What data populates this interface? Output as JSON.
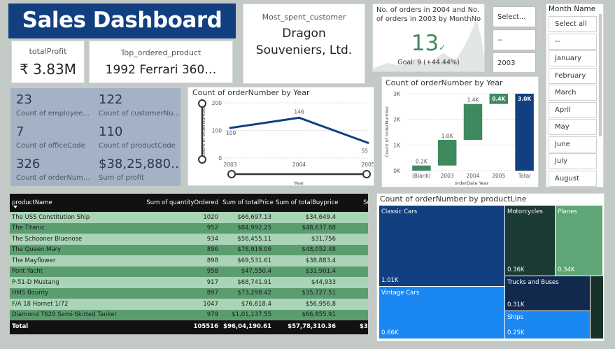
{
  "header": {
    "title": "Sales Dashboard"
  },
  "kpis": {
    "total_profit": {
      "label": "totalProfit",
      "value": "₹ 3.83M"
    },
    "top_product": {
      "label": "Top_ordered_product",
      "value": "1992 Ferrari 360…"
    },
    "most_spent": {
      "label": "Most_spent_customer",
      "value_line1": "Dragon",
      "value_line2": "Souveniers, Ltd."
    }
  },
  "goal_card": {
    "title_line1": "No. of orders in 2004 and No.",
    "title_line2": "of orders in 2003 by MonthNo",
    "value": "13",
    "check": "✓",
    "goal": "Goal: 9 (+44.44%)"
  },
  "slicers": {
    "select_label": "Select...",
    "dash_label": "--",
    "year_value": "2003",
    "chevron_icon": "chevron-down-icon"
  },
  "month_slicer": {
    "title": "Month Name",
    "items": [
      "Select all",
      "--",
      "January",
      "February",
      "March",
      "April",
      "May",
      "June",
      "July",
      "August"
    ]
  },
  "stats": [
    {
      "value": "23",
      "label": "Count of employee…"
    },
    {
      "value": "122",
      "label": "Count of customerNu…"
    },
    {
      "value": "7",
      "label": "Count of officeCode"
    },
    {
      "value": "110",
      "label": "Count of productCode"
    },
    {
      "value": "326",
      "label": "Count of orderNum…"
    },
    {
      "value": "$38,25,880…",
      "label": "Sum of profit"
    }
  ],
  "colors": {
    "title_bg": "#123f80",
    "stats_bg": "#a3b2c4",
    "line": "#123f80",
    "green": "#3e8a5e",
    "total_bar": "#123f80",
    "table_header": "#111111",
    "row_light": "#a9d5b6",
    "row_dark": "#5c9d70"
  },
  "chart_data": [
    {
      "type": "line",
      "title": "Count of orderNumber by Year",
      "xlabel": "Year",
      "ylabel": "Count of orderNumber",
      "x": [
        "2003",
        "2004",
        "2005"
      ],
      "series": [
        {
          "values": [
            109,
            146,
            55
          ]
        }
      ],
      "data_labels": [
        "109",
        "146",
        "55"
      ],
      "y_ticks": [
        "0",
        "100",
        "200"
      ],
      "ylim": [
        0,
        200
      ],
      "grid": true
    },
    {
      "type": "bar",
      "subtype": "waterfall",
      "title": "Count of orderNumber by Year",
      "xlabel": "orderDate Year",
      "ylabel": "Count of orderNumber",
      "categories": [
        "(Blank)",
        "2003",
        "2004",
        "2005",
        "Total"
      ],
      "values": [
        0.2,
        1.0,
        1.4,
        0.4,
        3.0
      ],
      "data_labels": [
        "0.2K",
        "1.0K",
        "1.4K",
        "0.4K",
        "3.0K"
      ],
      "y_ticks": [
        "0K",
        "1K",
        "2K",
        "3K"
      ],
      "ylim": [
        0,
        3
      ],
      "grid": true
    },
    {
      "type": "heatmap",
      "subtype": "treemap",
      "title": "Count of orderNumber by productLine",
      "categories": [
        "Classic Cars",
        "Vintage Cars",
        "Motorcycles",
        "Planes",
        "Trucks and Buses",
        "Ships"
      ],
      "values": [
        1.01,
        0.66,
        0.36,
        0.34,
        0.31,
        0.25
      ],
      "data_labels": [
        "1.01K",
        "0.66K",
        "0.36K",
        "0.34K",
        "0.31K",
        "0.25K"
      ],
      "colors": [
        "#123f80",
        "#1b87f2",
        "#1b3a33",
        "#5ea677",
        "#12294e",
        "#1b87f2"
      ]
    }
  ],
  "table": {
    "columns": [
      "productName",
      "Sum of quantityOrdered",
      "Sum of totalPrice",
      "Sum of totalBuyprice",
      "Sum of profi"
    ],
    "rows": [
      [
        "The USS Constitution Ship",
        "1020",
        "$66,697.13",
        "$34,649.4",
        "$32,047"
      ],
      [
        "The Titanic",
        "952",
        "$84,992.25",
        "$48,637.68",
        "$36,354"
      ],
      [
        "The Schooner Bluenose",
        "934",
        "$56,455.11",
        "$31,756",
        "$24,699"
      ],
      [
        "The Queen Mary",
        "896",
        "$78,919.06",
        "$48,052.48",
        "$30,866"
      ],
      [
        "The Mayflower",
        "898",
        "$69,531.61",
        "$38,883.4",
        "$30,648"
      ],
      [
        "Pont Yacht",
        "958",
        "$47,550.4",
        "$31,901.4",
        "$15,649"
      ],
      [
        "P-51-D Mustang",
        "917",
        "$68,741.91",
        "$44,933",
        "$23,808"
      ],
      [
        "HMS Bounty",
        "897",
        "$73,298.42",
        "$35,727.51",
        "$37,570"
      ],
      [
        "F/A 18 Hornet 1/72",
        "1047",
        "$76,618.4",
        "$56,956.8",
        "$19,661"
      ],
      [
        "Diamond T620 Semi-Skirted Tanker",
        "979",
        "$1,01,137.55",
        "$66,855.91",
        "$34,281"
      ]
    ],
    "total": [
      "Total",
      "105516",
      "$96,04,190.61",
      "$57,78,310.36",
      "$38,25,880."
    ]
  }
}
